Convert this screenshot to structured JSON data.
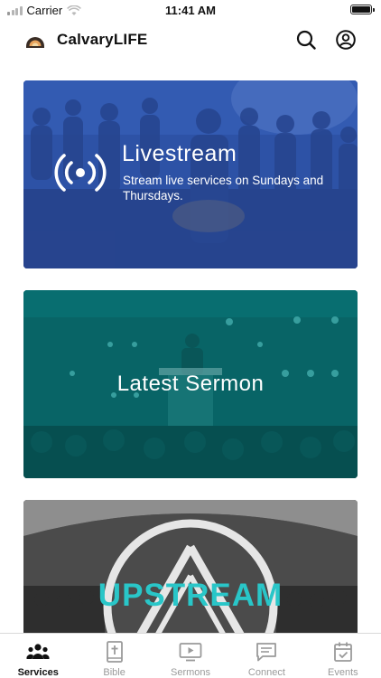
{
  "status_bar": {
    "carrier": "Carrier",
    "time": "11:41 AM"
  },
  "header": {
    "title": "CalvaryLIFE",
    "icons": [
      "search-icon",
      "profile-icon"
    ]
  },
  "cards": {
    "livestream": {
      "title": "Livestream",
      "subtitle": "Stream live services on Sundays and Thursdays."
    },
    "sermon": {
      "title": "Latest Sermon"
    },
    "upstream": {
      "logo_text": "UPSTREAM"
    }
  },
  "tabs": [
    {
      "label": "Services",
      "icon": "people-icon",
      "active": true
    },
    {
      "label": "Bible",
      "icon": "bible-icon",
      "active": false
    },
    {
      "label": "Sermons",
      "icon": "video-icon",
      "active": false
    },
    {
      "label": "Connect",
      "icon": "chat-icon",
      "active": false
    },
    {
      "label": "Events",
      "icon": "calendar-icon",
      "active": false
    }
  ],
  "colors": {
    "livestream_tint": "#3a5ba8",
    "sermon_tint": "#0f6e70",
    "upstream_accent": "#29c6c8",
    "tab_active": "#111111",
    "tab_inactive": "#9a9a9a"
  }
}
